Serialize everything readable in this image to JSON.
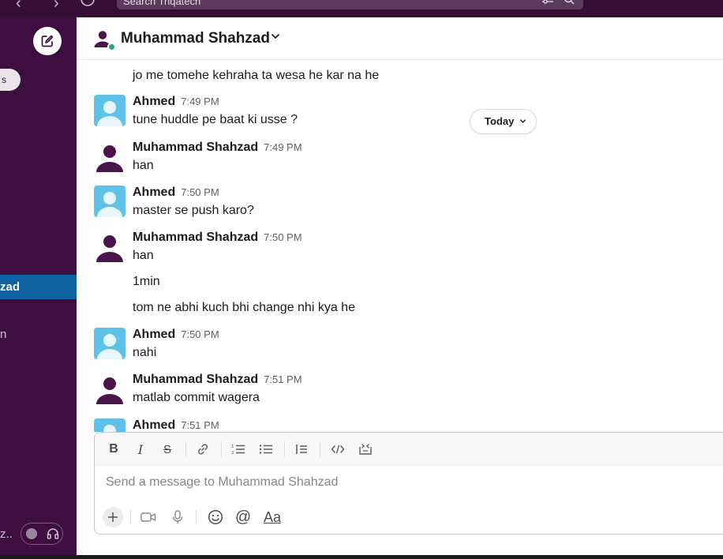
{
  "topbar": {
    "search_placeholder": "Search Triqatech"
  },
  "sidebar": {
    "pill_label": "s",
    "active_item_label": "zad",
    "item_2_label": "n",
    "footer_label": "z.."
  },
  "header": {
    "title": "Muhammad Shahzad"
  },
  "messages": {
    "today_label": "Today",
    "continuation_0": "jo me tomehe kehraha ta wesa he kar na he",
    "m1": {
      "sender": "Ahmed",
      "time": "7:49 PM",
      "text": "tune huddle pe baat ki usse ?"
    },
    "m2": {
      "sender": "Muhammad Shahzad",
      "time": "7:49 PM",
      "text": "han"
    },
    "m3": {
      "sender": "Ahmed",
      "time": "7:50 PM",
      "text": "master se push karo?"
    },
    "m4": {
      "sender": "Muhammad Shahzad",
      "time": "7:50 PM",
      "text": "han",
      "text2": "1min",
      "text3": "tom ne abhi kuch bhi change nhi kya he"
    },
    "m5": {
      "sender": "Ahmed",
      "time": "7:50 PM",
      "text": "nahi"
    },
    "m6": {
      "sender": "Muhammad Shahzad",
      "time": "7:51 PM",
      "text": "matlab commit wagera"
    },
    "m7": {
      "sender": "Ahmed",
      "time": "7:51 PM"
    }
  },
  "composer": {
    "placeholder": "Send a message to Muhammad Shahzad",
    "text_format_label": "Aa"
  },
  "colors": {
    "sidebar_bg": "#3f0e40",
    "active_item": "#1164a3",
    "ahmed_avatar_bg": "#5ec2e8",
    "shahzad_avatar_fg": "#4a154b",
    "presence": "#2bac76"
  }
}
